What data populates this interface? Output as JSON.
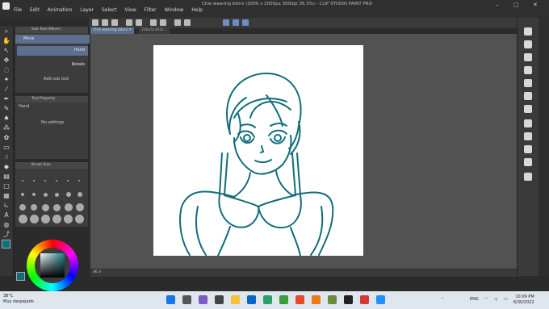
{
  "window": {
    "doc_title": "Chie wearing bikini (2000 x 2000px 300dpi 36.3%) - CLIP STUDIO PAINT PRO",
    "menus": [
      "File",
      "Edit",
      "Animation",
      "Layer",
      "Select",
      "View",
      "Filter",
      "Window",
      "Help"
    ],
    "controls": {
      "minimize": "–",
      "maximize": "□",
      "close": "✕"
    }
  },
  "tabs": [
    {
      "label": "Chie wearing bikini",
      "close": "✕"
    },
    {
      "label": "2dbe5c3d3c..."
    }
  ],
  "subtool_panel": {
    "header": "Sub Tool [Move]",
    "group": "Move",
    "selected_item": "Hand",
    "item2": "Rotate",
    "add_label": "Add sub tool"
  },
  "tool_property": {
    "header": "Tool Property",
    "name": "Hand",
    "message": "No settings"
  },
  "brush_size": {
    "header": "Brush Size"
  },
  "canvas": {
    "zoom": "36.3"
  },
  "colors": {
    "main": "#0d6f7c",
    "stroke": "#0f6e7a"
  },
  "taskbar": {
    "weather_temp": "38°C",
    "weather_desc": "Muy despejado",
    "lang": "ENG",
    "time": "10:09 PM",
    "date": "6/30/2022"
  }
}
